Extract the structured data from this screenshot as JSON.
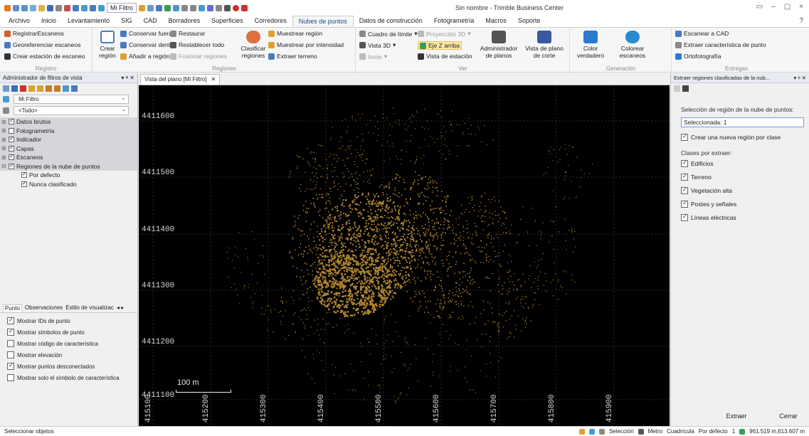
{
  "titlebar": {
    "filter": "Mi Filtro",
    "title": "Sin nombre - Trimble Business Center"
  },
  "menu": [
    "Archivo",
    "Inicio",
    "Levantamiento",
    "SIG",
    "CAD",
    "Borradores",
    "Superficies",
    "Corredores",
    "Nubes de puntos",
    "Datos de construcción",
    "Fotogrametría",
    "Macros",
    "Soporte"
  ],
  "menu_active": "Nubes de puntos",
  "help": "?",
  "ribbon": {
    "registro": {
      "label": "Registro",
      "b1": "RegistrarEscaneos",
      "b2": "Georeferenciar escaneos",
      "b3": "Crear estación de escaneo"
    },
    "regiones": {
      "label": "Regiones",
      "crear": "Crear región",
      "c1": "Conservar fuera",
      "c2": "Conservar dentro",
      "c3": "Añadir a región",
      "d1": "Restaurar",
      "d2": "Restablecer todo",
      "d3": "Fusionar regiones",
      "clasificar": "Clasificar regiones",
      "m1": "Muestrear región",
      "m2": "Muestrear por intensidad",
      "m3": "Extraer terreno"
    },
    "ver": {
      "label": "Ver",
      "v1": "Cuadro de límite",
      "v2": "Vista 3D",
      "v3": "Inicio",
      "p1": "Proyección 3D",
      "p2": "Eje Z arriba",
      "p3": "Vista de estación",
      "adm": "Administrador de planos",
      "vpc": "Vista de plano de corte"
    },
    "gen": {
      "label": "Generación",
      "color": "Color verdadero",
      "colorear": "Colorear escaneos"
    },
    "ent": {
      "label": "Entregas",
      "e1": "Escanear a CAD",
      "e2": "Extraer característica de punto",
      "e3": "Ortofotografía"
    }
  },
  "left": {
    "title": "Administrador de filtros de vista",
    "filter": "Mi Filtro",
    "todo": "<Todo>",
    "tree": [
      {
        "label": "Datos brutos",
        "checked": true
      },
      {
        "label": "Fotogrametría",
        "checked": false
      },
      {
        "label": "Indicador",
        "checked": true
      },
      {
        "label": "Capas",
        "checked": true
      },
      {
        "label": "Escaneos",
        "checked": true
      },
      {
        "label": "Regiones de la nube de puntos",
        "checked": true
      }
    ],
    "sub": [
      {
        "label": "Por defecto",
        "checked": true
      },
      {
        "label": "Nunca clasificado",
        "checked": true
      }
    ],
    "tabs": [
      "Punto",
      "Observaciones",
      "Estilo de visualizac"
    ],
    "options": [
      {
        "label": "Mostrar IDs de punto",
        "checked": true
      },
      {
        "label": "Mostrar símbolos de punto",
        "checked": true
      },
      {
        "label": "Mostrar código de característica",
        "checked": false
      },
      {
        "label": "Mostrar elevación",
        "checked": false
      },
      {
        "label": "Mostrar puntos desconectados",
        "checked": true
      },
      {
        "label": "Mostrar solo el símbolo de característica",
        "checked": false
      }
    ]
  },
  "view": {
    "tab": "Vista del plano [Mi Filtro]",
    "ylabels": [
      "4411600",
      "4411500",
      "4411400",
      "4411300",
      "4411200",
      "4411100"
    ],
    "xlabels": [
      "415100",
      "415200",
      "415300",
      "415400",
      "415500",
      "415600",
      "415700",
      "415800",
      "415900"
    ],
    "scale": "100 m",
    "point_color": "#b08530"
  },
  "right": {
    "title": "Extraer regiones clasificadas de la nub...",
    "sel_label": "Selección de región de la nube de puntos:",
    "sel_value": "Seleccionada: 1",
    "crear": "Crear una nueva región por clase",
    "clases_label": "Clases por extraer:",
    "classes": [
      "Edificios",
      "Terreno",
      "Vegetación alta",
      "Postes y señales",
      "Líneas eléctricas"
    ],
    "extraer": "Extraer",
    "cerrar": "Cerrar"
  },
  "status": {
    "left": "Seleccionar objetos",
    "seleccion": "Selección",
    "metro": "Metro",
    "cuadricula": "Cuadrícula",
    "defecto": "Por defecto",
    "one": "1",
    "coords": "961.519 m,613.607 m"
  }
}
